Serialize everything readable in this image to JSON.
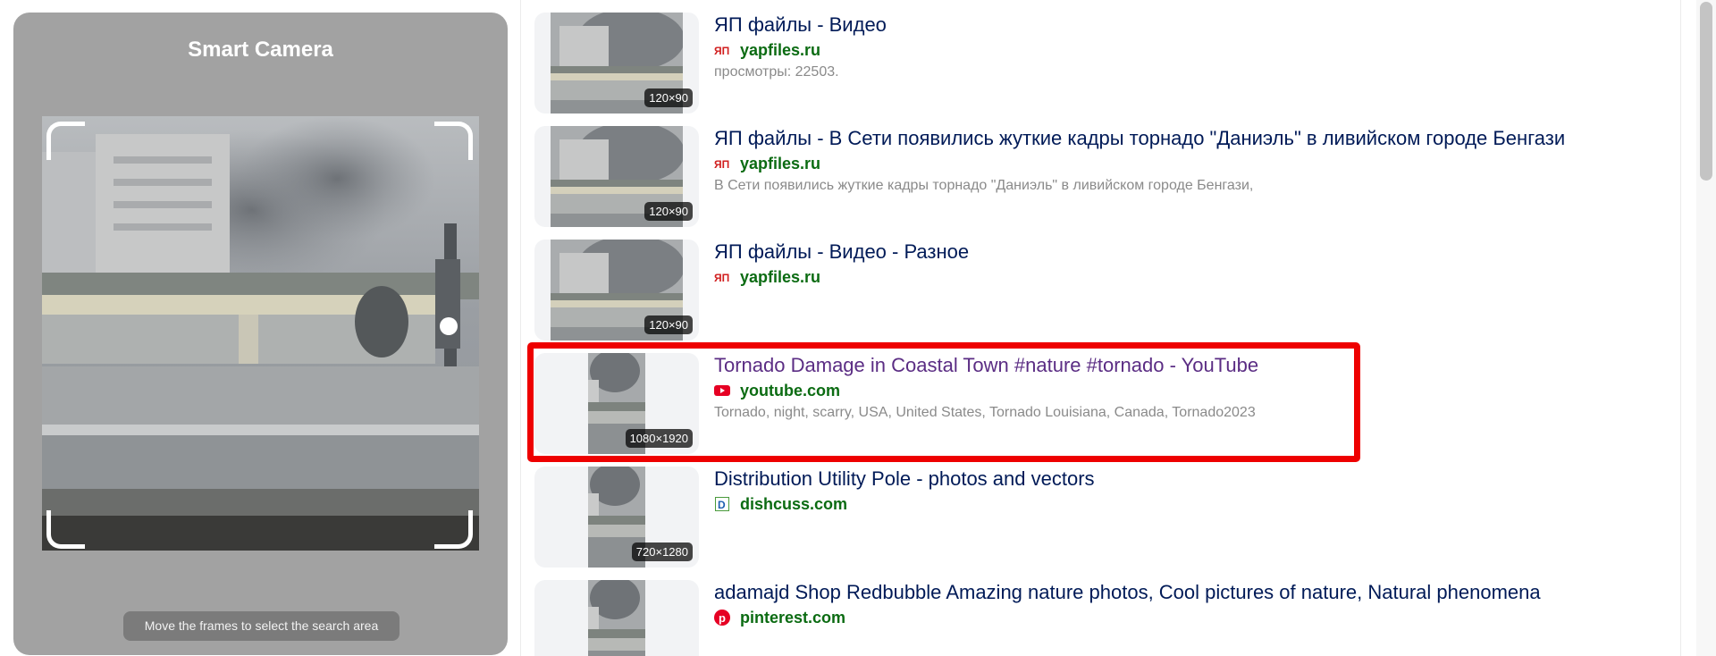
{
  "camera": {
    "title": "Smart Camera",
    "hint": "Move the frames to select the search area"
  },
  "results": [
    {
      "title": "ЯП файлы - Видео",
      "site": "yapfiles.ru",
      "favicon": "yapfiles-icon",
      "description": "просмотры: 22503.",
      "size": "120×90"
    },
    {
      "title": "ЯП файлы - В Сети появились жуткие кадры торнадо \"Даниэль\" в ливийском городе Бенгази",
      "site": "yapfiles.ru",
      "favicon": "yapfiles-icon",
      "description": "В Сети появились жуткие кадры торнадо \"Даниэль\" в ливийском городе Бенгази,",
      "size": "120×90"
    },
    {
      "title": "ЯП файлы - Видео - Разное",
      "site": "yapfiles.ru",
      "favicon": "yapfiles-icon",
      "description": "",
      "size": "120×90"
    },
    {
      "title": "Tornado Damage in Coastal Town #nature #tornado - YouTube",
      "site": "youtube.com",
      "favicon": "youtube-icon",
      "description": "Tornado, night, scarry, USA, United States, Tornado Louisiana, Canada, Tornado2023",
      "size": "1080×1920"
    },
    {
      "title": "Distribution Utility Pole - photos and vectors",
      "site": "dishcuss.com",
      "favicon": "dishcuss-icon",
      "description": "",
      "size": "720×1280"
    },
    {
      "title": "adamajd Shop Redbubble Amazing nature photos, Cool pictures of nature, Natural phenomena",
      "site": "pinterest.com",
      "favicon": "pinterest-icon",
      "description": "",
      "size": ""
    }
  ],
  "colors": {
    "accent_highlight": "#ee0000",
    "link_title": "#001a57",
    "visited_title": "#5b2d84",
    "site_link": "#0b6b12"
  }
}
